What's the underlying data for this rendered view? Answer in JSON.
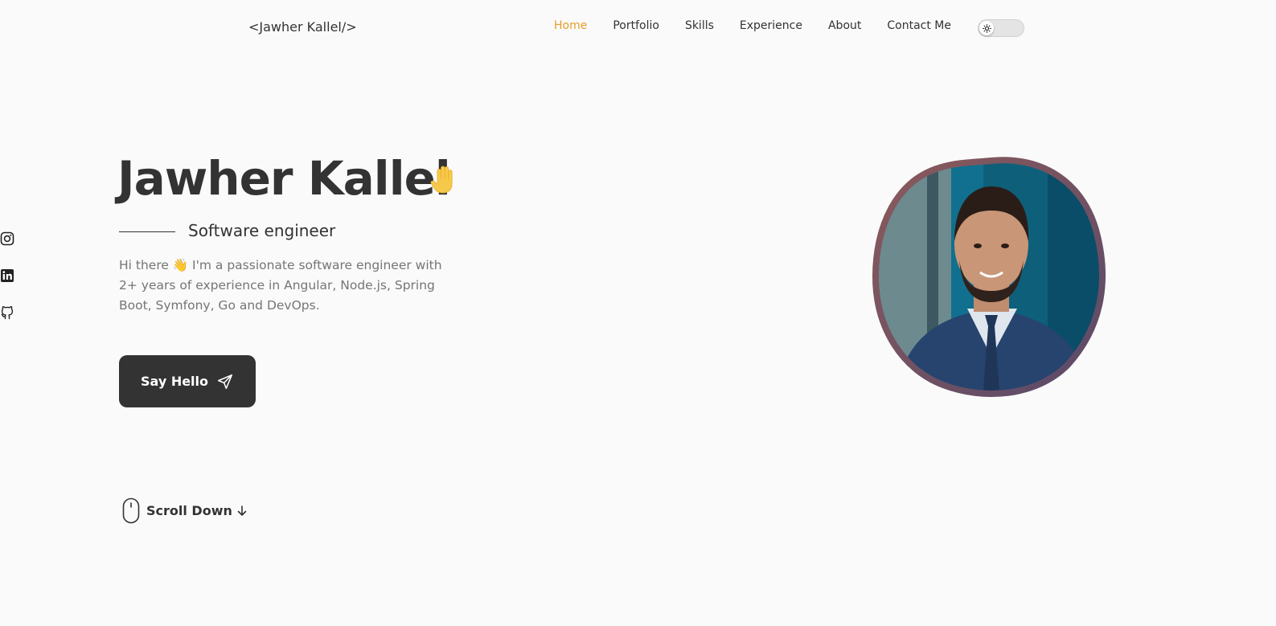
{
  "header": {
    "logo": "<Jawher Kallel/>",
    "nav": [
      {
        "label": "Home",
        "active": true
      },
      {
        "label": "Portfolio"
      },
      {
        "label": "Skills"
      },
      {
        "label": "Experience"
      },
      {
        "label": "About"
      },
      {
        "label": "Contact Me"
      }
    ],
    "theme_toggle_icon": "sun-icon"
  },
  "social": [
    "instagram-icon",
    "linkedin-icon",
    "github-icon"
  ],
  "hero": {
    "name": "Jawher Kallel",
    "name_emoji_icon": "waving-hand-icon",
    "subtitle": "Software engineer",
    "description": "Hi there 👋 I'm a passionate software engineer with 2+ years of experience in Angular, Node.js, Spring Boot, Symfony, Go and DevOps.",
    "cta_label": "Say Hello",
    "cta_icon": "send-icon"
  },
  "scroll": {
    "label": "Scroll Down",
    "icon": "mouse-icon",
    "arrow_icon": "arrow-down-icon"
  },
  "colors": {
    "accent": "#e79d2a",
    "text_dark": "#333333",
    "text_muted": "#757575",
    "background": "#fafafa"
  }
}
